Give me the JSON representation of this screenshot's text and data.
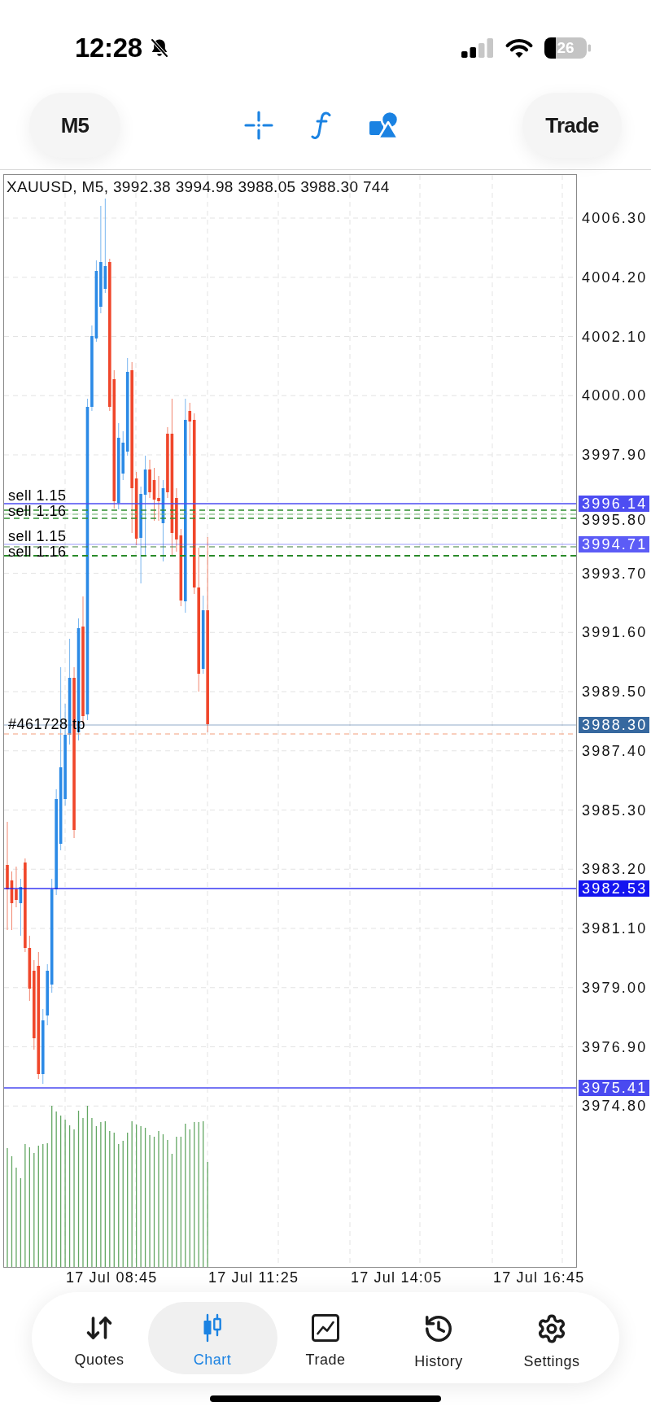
{
  "status_bar": {
    "time": "12:28",
    "battery": "26"
  },
  "toolbar": {
    "timeframe": "M5",
    "trade_button": "Trade"
  },
  "chart": {
    "header": "XAUUSD, M5, 3992.38 3994.98 3988.05 3988.30 744",
    "price_ticks": [
      "4006.30",
      "4004.20",
      "4002.10",
      "4000.00",
      "3997.90",
      "3995.80",
      "3993.70",
      "3991.60",
      "3989.50",
      "3987.40",
      "3985.30",
      "3983.20",
      "3981.10",
      "3979.00",
      "3976.90",
      "3974.80"
    ],
    "levels": [
      {
        "tag": "3996.14",
        "color": "#4d4df2"
      },
      {
        "tag": "3994.71",
        "color": "#5c5cf6"
      },
      {
        "tag": "3988.30",
        "color": "#36689f"
      },
      {
        "tag": "3982.53",
        "color": "#1414f0"
      },
      {
        "tag": "3975.41",
        "color": "#4a4af0"
      }
    ],
    "trade_labels": [
      "sell 1.15",
      "sell 1.16",
      "sell 1.15",
      "sell 1.16",
      "#461728 tp"
    ],
    "time_ticks": [
      "17 Jul 08:45",
      "17 Jul 11:25",
      "17 Jul 14:05",
      "17 Jul 16:45"
    ]
  },
  "tab_bar": {
    "items": [
      {
        "label": "Quotes",
        "selected": false
      },
      {
        "label": "Chart",
        "selected": true
      },
      {
        "label": "Trade",
        "selected": false
      },
      {
        "label": "History",
        "selected": false
      },
      {
        "label": "Settings",
        "selected": false
      }
    ]
  }
}
